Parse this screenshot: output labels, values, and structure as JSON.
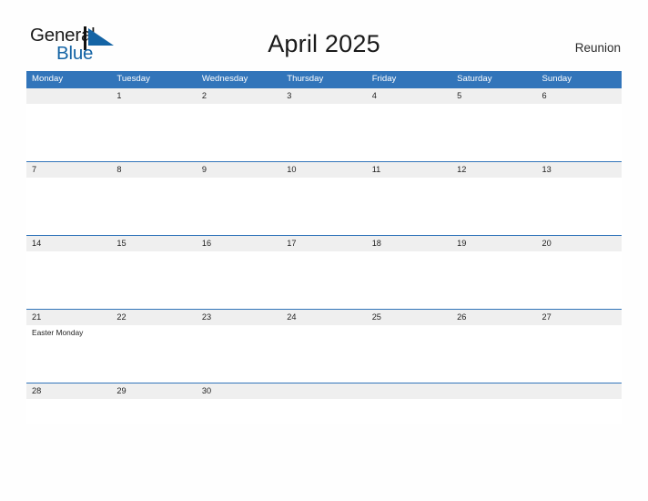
{
  "brand": {
    "name_part1": "General",
    "name_part2": "Blue",
    "mark": "blue-triangle-logo-icon",
    "color_dark": "#1a1a1a",
    "color_blue": "#1464a5"
  },
  "header": {
    "title": "April 2025",
    "region": "Reunion"
  },
  "calendar": {
    "accent_color": "#3275ba",
    "date_band_color": "#efefef",
    "weekdays": [
      "Monday",
      "Tuesday",
      "Wednesday",
      "Thursday",
      "Friday",
      "Saturday",
      "Sunday"
    ],
    "weeks": [
      {
        "days": [
          {
            "num": "",
            "events": []
          },
          {
            "num": "1",
            "events": []
          },
          {
            "num": "2",
            "events": []
          },
          {
            "num": "3",
            "events": []
          },
          {
            "num": "4",
            "events": []
          },
          {
            "num": "5",
            "events": []
          },
          {
            "num": "6",
            "events": []
          }
        ]
      },
      {
        "days": [
          {
            "num": "7",
            "events": []
          },
          {
            "num": "8",
            "events": []
          },
          {
            "num": "9",
            "events": []
          },
          {
            "num": "10",
            "events": []
          },
          {
            "num": "11",
            "events": []
          },
          {
            "num": "12",
            "events": []
          },
          {
            "num": "13",
            "events": []
          }
        ]
      },
      {
        "days": [
          {
            "num": "14",
            "events": []
          },
          {
            "num": "15",
            "events": []
          },
          {
            "num": "16",
            "events": []
          },
          {
            "num": "17",
            "events": []
          },
          {
            "num": "18",
            "events": []
          },
          {
            "num": "19",
            "events": []
          },
          {
            "num": "20",
            "events": []
          }
        ]
      },
      {
        "days": [
          {
            "num": "21",
            "events": [
              "Easter Monday"
            ]
          },
          {
            "num": "22",
            "events": []
          },
          {
            "num": "23",
            "events": []
          },
          {
            "num": "24",
            "events": []
          },
          {
            "num": "25",
            "events": []
          },
          {
            "num": "26",
            "events": []
          },
          {
            "num": "27",
            "events": []
          }
        ]
      },
      {
        "days": [
          {
            "num": "28",
            "events": []
          },
          {
            "num": "29",
            "events": []
          },
          {
            "num": "30",
            "events": []
          },
          {
            "num": "",
            "events": []
          },
          {
            "num": "",
            "events": []
          },
          {
            "num": "",
            "events": []
          },
          {
            "num": "",
            "events": []
          }
        ]
      }
    ]
  }
}
